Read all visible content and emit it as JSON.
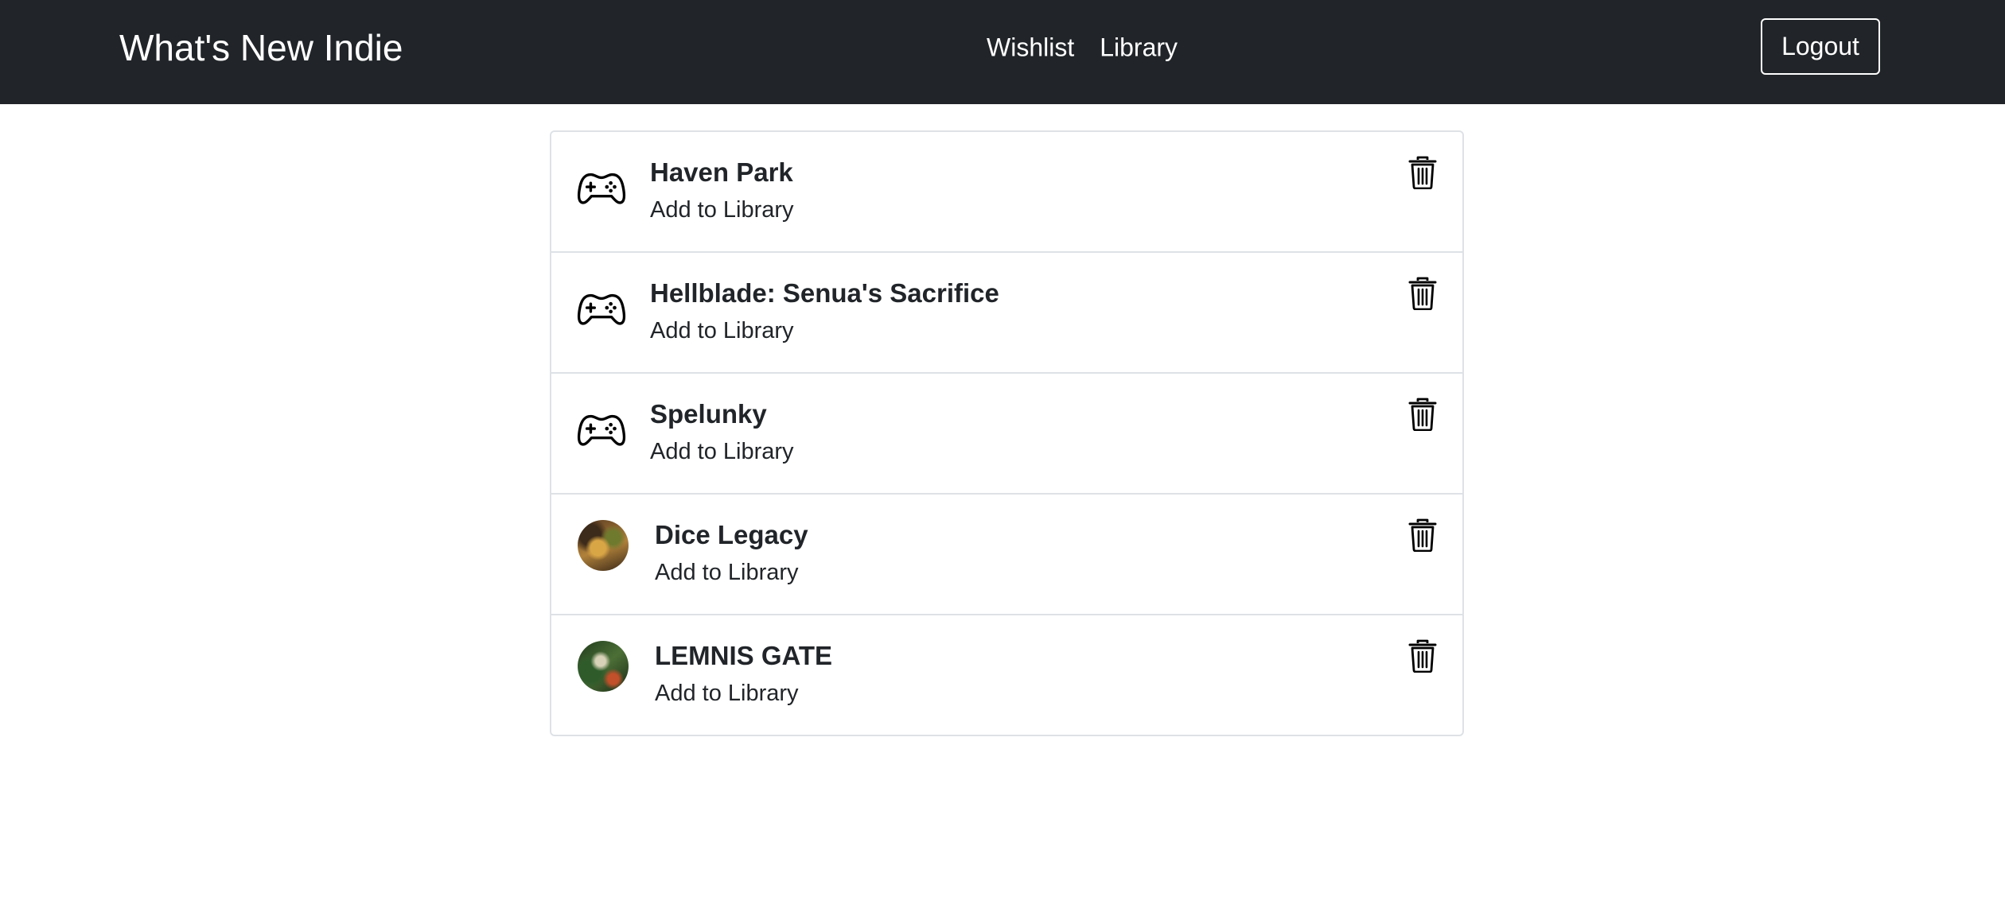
{
  "navbar": {
    "brand": "What's New Indie",
    "links": [
      "Wishlist",
      "Library"
    ],
    "logout_label": "Logout"
  },
  "games": [
    {
      "title": "Haven Park",
      "action": "Add to Library",
      "icon": "gamepad-icon"
    },
    {
      "title": "Hellblade: Senua's Sacrifice",
      "action": "Add to Library",
      "icon": "gamepad-icon"
    },
    {
      "title": "Spelunky",
      "action": "Add to Library",
      "icon": "gamepad-icon"
    },
    {
      "title": "Dice Legacy",
      "action": "Add to Library",
      "icon": "game-cover-image"
    },
    {
      "title": "LEMNIS GATE",
      "action": "Add to Library",
      "icon": "game-cover-image"
    }
  ],
  "delete_icon": "trash-icon",
  "colors": {
    "navbar_bg": "#212529",
    "text": "#212529",
    "border": "#dee2e6"
  }
}
